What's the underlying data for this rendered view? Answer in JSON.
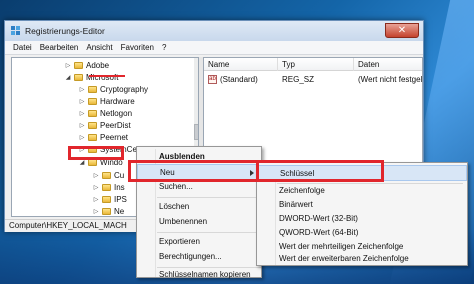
{
  "window": {
    "title": "Registrierungs-Editor",
    "close_symbol": "✕"
  },
  "menubar": {
    "items": [
      "Datei",
      "Bearbeiten",
      "Ansicht",
      "Favoriten",
      "?"
    ]
  },
  "tree": {
    "items": [
      {
        "label": "Adobe",
        "toggle": "▷"
      },
      {
        "label": "Microsoft",
        "toggle": "◢"
      },
      {
        "label": "Cryptography",
        "toggle": "▷"
      },
      {
        "label": "Hardware",
        "toggle": "▷"
      },
      {
        "label": "Netlogon",
        "toggle": "▷"
      },
      {
        "label": "PeerDist",
        "toggle": "▷"
      },
      {
        "label": "Peernet",
        "toggle": "▷"
      },
      {
        "label": "SystemCertificates",
        "toggle": "▷"
      },
      {
        "label": "Windo",
        "toggle": "◢"
      },
      {
        "label": "Cu",
        "toggle": "▷"
      },
      {
        "label": "Ins",
        "toggle": "▷"
      },
      {
        "label": "IPS",
        "toggle": "▷"
      },
      {
        "label": "Ne",
        "toggle": "▷"
      }
    ]
  },
  "list": {
    "columns": [
      "Name",
      "Typ",
      "Daten"
    ],
    "rows": [
      {
        "icon": "ab",
        "name": "(Standard)",
        "type": "REG_SZ",
        "data": "(Wert nicht festgele"
      }
    ]
  },
  "statusbar": {
    "path": "Computer\\HKEY_LOCAL_MACH"
  },
  "context_menu": {
    "items": [
      "Ausblenden",
      "Neu",
      "Suchen...",
      "Löschen",
      "Umbenennen",
      "Exportieren",
      "Berechtigungen...",
      "Schlüsselnamen kopieren"
    ]
  },
  "submenu": {
    "items": [
      "Schlüssel",
      "Zeichenfolge",
      "Binärwert",
      "DWORD-Wert (32-Bit)",
      "QWORD-Wert (64-Bit)",
      "Wert der mehrteiligen Zeichenfolge",
      "Wert der erweiterbaren Zeichenfolge"
    ]
  },
  "colors": {
    "highlight_box": "#e1262c",
    "menu_hover": "#d8e6f6"
  }
}
